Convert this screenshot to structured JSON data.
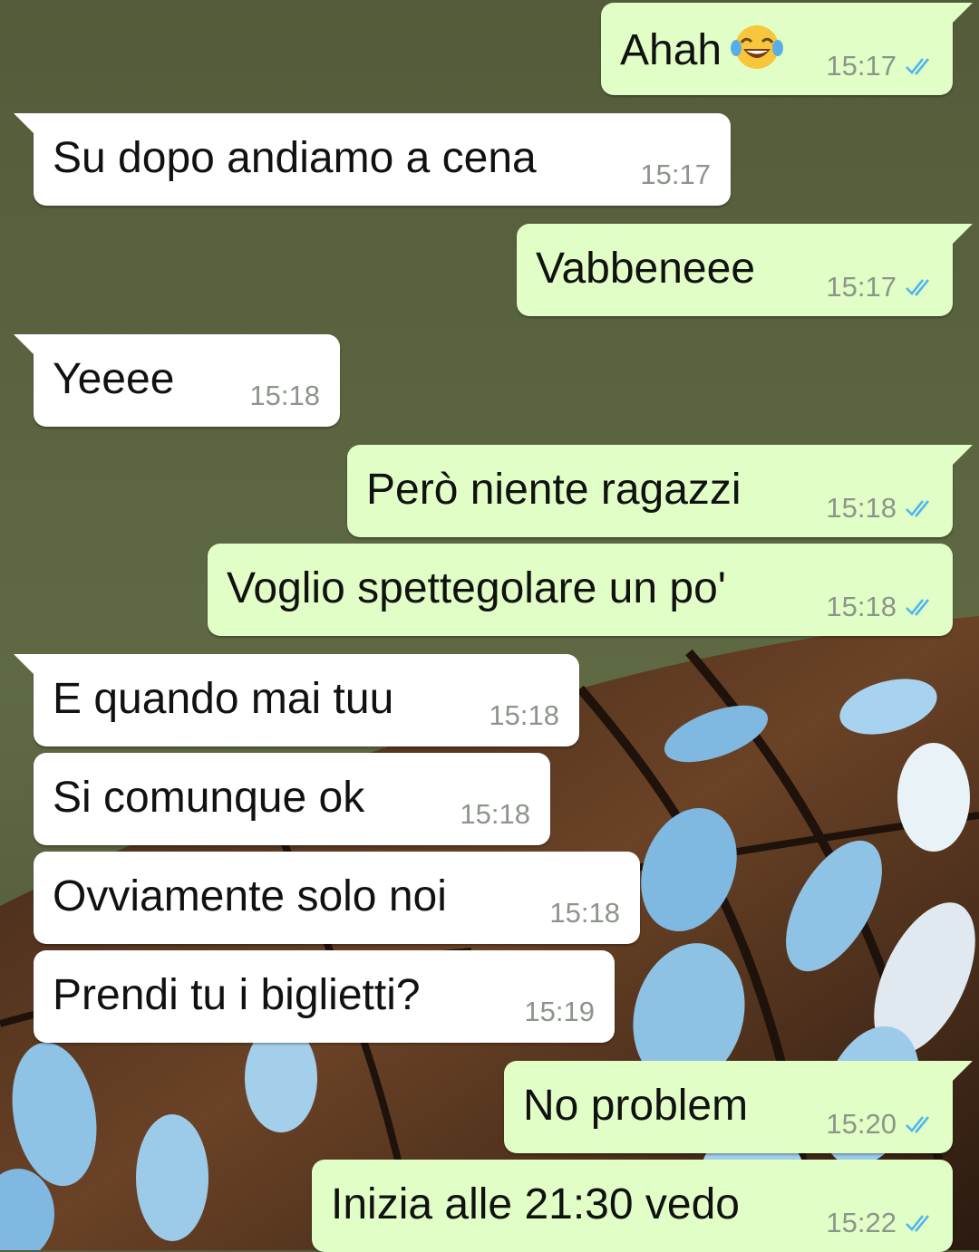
{
  "colors": {
    "outgoing_bubble": "#e1fec6",
    "incoming_bubble": "#ffffff",
    "read_tick": "#4fb6ec",
    "time_text": "#8c958a",
    "wallpaper_top": "#565d3c"
  },
  "messages": [
    {
      "direction": "out",
      "text": "Ahah",
      "emoji": "joy-emoji",
      "time": "15:17",
      "status": "read"
    },
    {
      "direction": "in",
      "text": "Su dopo andiamo a cena",
      "time": "15:17"
    },
    {
      "direction": "out",
      "text": "Vabbeneee",
      "time": "15:17",
      "status": "read"
    },
    {
      "direction": "in",
      "text": "Yeeee",
      "time": "15:18"
    },
    {
      "direction": "out",
      "text": "Però niente ragazzi",
      "time": "15:18",
      "status": "read"
    },
    {
      "direction": "out",
      "text": "Voglio spettegolare un po'",
      "time": "15:18",
      "status": "read"
    },
    {
      "direction": "in",
      "text": "E quando mai tuu",
      "time": "15:18"
    },
    {
      "direction": "in",
      "text": "Si comunque ok",
      "time": "15:18"
    },
    {
      "direction": "in",
      "text": "Ovviamente solo noi",
      "time": "15:18"
    },
    {
      "direction": "in",
      "text": "Prendi tu i biglietti?",
      "time": "15:19"
    },
    {
      "direction": "out",
      "text": "No problem",
      "time": "15:20",
      "status": "read"
    },
    {
      "direction": "out",
      "text": "Inizia alle 21:30 vedo",
      "time": "15:22",
      "status": "read"
    }
  ]
}
